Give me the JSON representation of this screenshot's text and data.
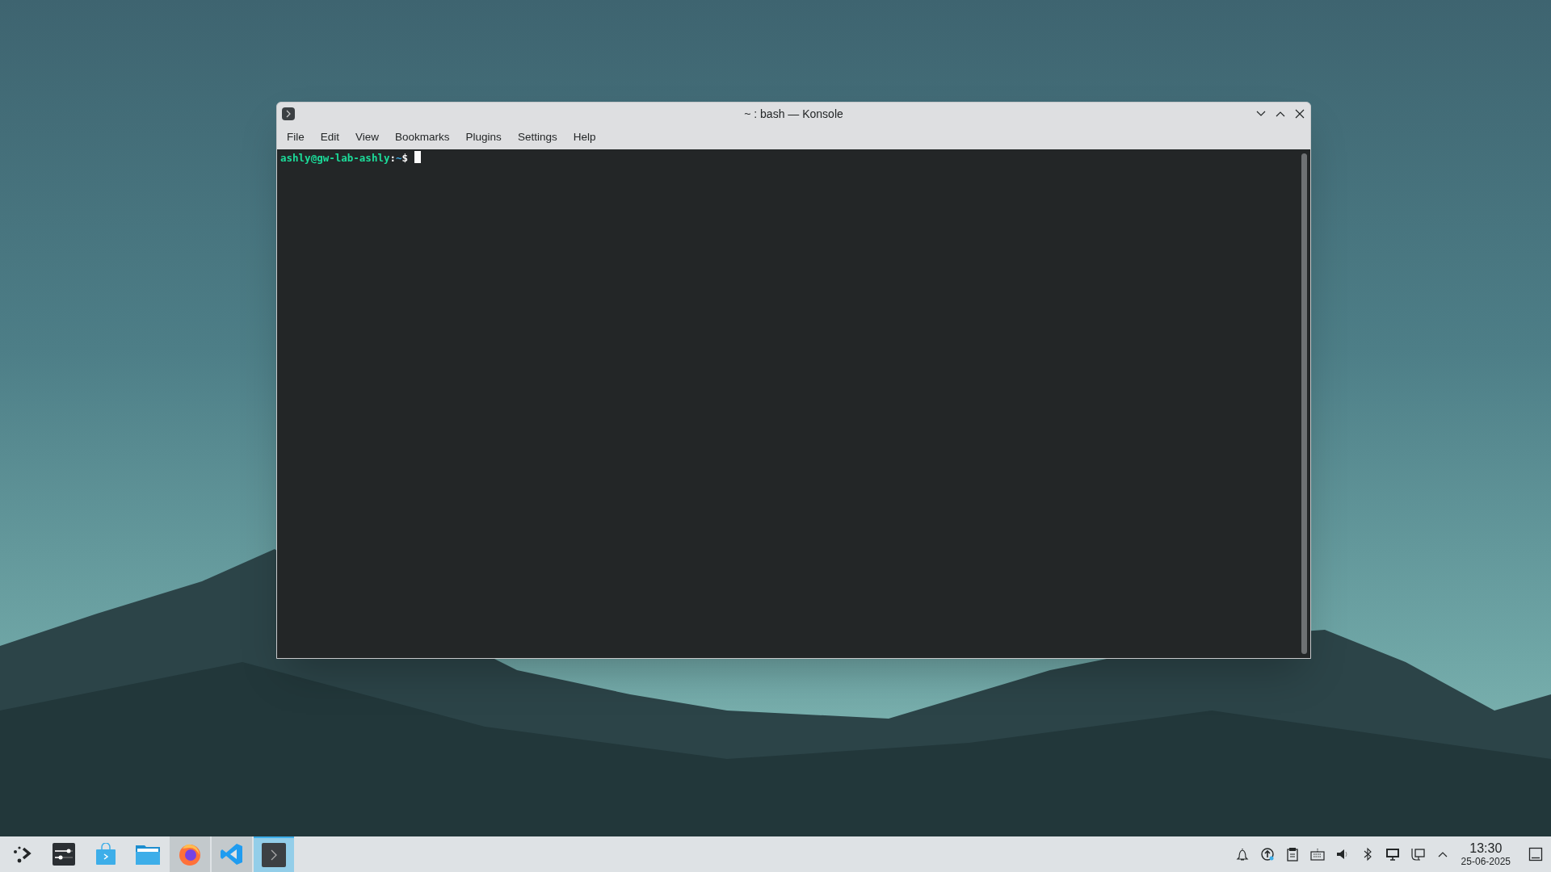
{
  "window": {
    "title": "~ : bash — Konsole",
    "menu": [
      "File",
      "Edit",
      "View",
      "Bookmarks",
      "Plugins",
      "Settings",
      "Help"
    ],
    "terminal": {
      "user_host": "ashly@gw-lab-ashly",
      "separator": ":",
      "path": "~",
      "prompt": "$"
    }
  },
  "taskbar": {
    "apps": [
      {
        "kind": "launcher",
        "running": false,
        "selected": false
      },
      {
        "kind": "settings",
        "running": false,
        "selected": false
      },
      {
        "kind": "store",
        "running": false,
        "selected": false
      },
      {
        "kind": "files",
        "running": false,
        "selected": false
      },
      {
        "kind": "browser",
        "running": true,
        "selected": false
      },
      {
        "kind": "editor",
        "running": true,
        "selected": false
      },
      {
        "kind": "terminal",
        "running": true,
        "selected": true
      }
    ],
    "tray": [
      {
        "kind": "notifications"
      },
      {
        "kind": "updates"
      },
      {
        "kind": "clipboard"
      },
      {
        "kind": "keyboard"
      },
      {
        "kind": "volume"
      },
      {
        "kind": "bluetooth"
      },
      {
        "kind": "display"
      },
      {
        "kind": "network"
      },
      {
        "kind": "expand"
      }
    ],
    "time": "13:30",
    "date": "25-06-2025"
  }
}
